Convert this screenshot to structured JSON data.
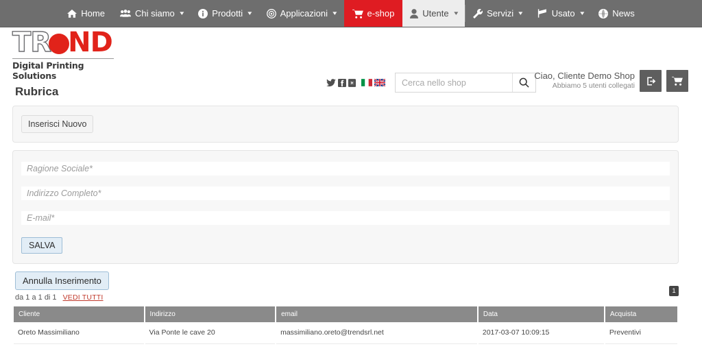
{
  "navbar": {
    "items": [
      {
        "label": "Home",
        "icon": "home-icon",
        "caret": false,
        "style": "normal"
      },
      {
        "label": "Chi siamo",
        "icon": "users-icon",
        "caret": true,
        "style": "normal"
      },
      {
        "label": "Prodotti",
        "icon": "info-circle-icon",
        "caret": true,
        "style": "normal"
      },
      {
        "label": "Applicazioni",
        "icon": "target-icon",
        "caret": true,
        "style": "normal"
      },
      {
        "label": "e-shop",
        "icon": "cart-icon",
        "caret": false,
        "style": "eshop"
      },
      {
        "label": "Utente",
        "icon": "user-icon",
        "caret": true,
        "style": "active"
      },
      {
        "label": "Servizi",
        "icon": "wrench-icon",
        "caret": true,
        "style": "normal"
      },
      {
        "label": "Usato",
        "icon": "bullhorn-icon",
        "caret": true,
        "style": "normal"
      },
      {
        "label": "News",
        "icon": "globe-icon",
        "caret": false,
        "style": "normal"
      }
    ],
    "colors": {
      "background": "#6e6e6e",
      "eshop": "#df1c22",
      "active_bg": "#ededed"
    }
  },
  "header": {
    "logo": {
      "part1": "TR",
      "part2": "ND",
      "subtitle": "Digital Printing Solutions",
      "accent": "#e1231a"
    },
    "social": [
      {
        "name": "twitter-icon"
      },
      {
        "name": "facebook-icon"
      },
      {
        "name": "youtube-icon"
      }
    ],
    "flags": [
      {
        "name": "flag-italy-icon"
      },
      {
        "name": "flag-uk-icon"
      }
    ],
    "search": {
      "placeholder": "Cerca nello shop",
      "value": "",
      "button_icon": "search-icon"
    },
    "greeting": {
      "line1": "Ciao, Cliente Demo Shop",
      "line2": "Abbiamo 5 utenti collegati"
    },
    "actions": [
      {
        "name": "logout-button",
        "icon": "logout-icon"
      },
      {
        "name": "cart-button",
        "icon": "cart-icon"
      }
    ]
  },
  "main": {
    "page_title": "Rubrica",
    "insert_button": "Inserisci Nuovo",
    "form": {
      "fields": [
        {
          "name": "ragione-sociale-field",
          "placeholder": "Ragione Sociale*",
          "value": ""
        },
        {
          "name": "indirizzo-completo-field",
          "placeholder": "Indirizzo Completo*",
          "value": ""
        },
        {
          "name": "email-field",
          "placeholder": "E-mail*",
          "value": ""
        }
      ],
      "save_button": "SALVA"
    },
    "cancel_button": "Annulla Inserimento",
    "pager": {
      "info": "da 1 a 1 di 1",
      "view_all": "VEDI TUTTI",
      "current_page": "1"
    },
    "table": {
      "columns": [
        "Cliente",
        "Indirizzo",
        "email",
        "Data",
        "Acquista"
      ],
      "rows": [
        {
          "cliente": "Oreto Massimiliano",
          "indirizzo": "Via Ponte le cave 20",
          "email": "massimiliano.oreto@trendsrl.net",
          "data": "2017-03-07 10:09:15",
          "acquista": "Preventivi"
        }
      ]
    }
  }
}
